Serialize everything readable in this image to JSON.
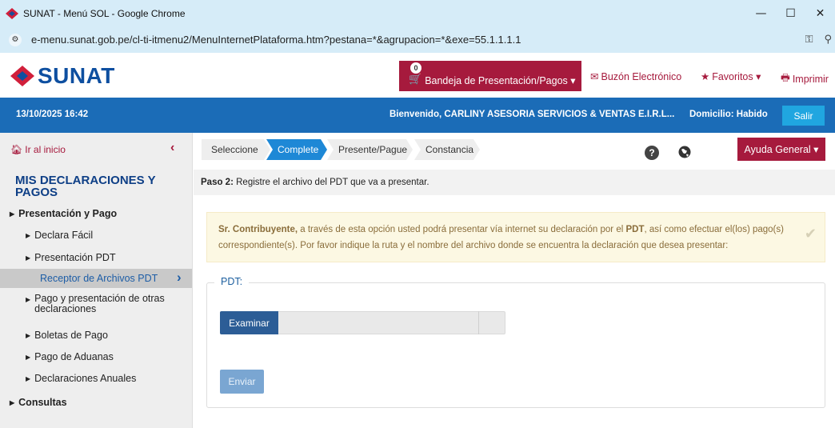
{
  "browser": {
    "window_title": "SUNAT - Menú SOL - Google Chrome",
    "url": "e-menu.sunat.gob.pe/cl-ti-itmenu2/MenuInternetPlataforma.htm?pestana=*&agrupacion=*&exe=55.1.1.1.1",
    "minimize": "—",
    "maximize": "☐",
    "close": "✕",
    "site_info": "⚙",
    "key_icon": "⚿",
    "zoom_icon": "⚲"
  },
  "header": {
    "logo_text": "SUNAT",
    "bandeja_label": "Bandeja de Presentación/Pagos ▾",
    "bandeja_badge": "0",
    "buzon_label": "Buzón Electrónico",
    "favoritos_label": "Favoritos ▾",
    "imprimir_label": "Imprimir"
  },
  "status_bar": {
    "datetime": "13/10/2025 16:42",
    "welcome": "Bienvenido, CARLINY ASESORIA SERVICIOS & VENTAS E.I.R.L...",
    "domicilio": "Domicilio: Habido",
    "salir": "Salir"
  },
  "sidebar": {
    "home_label": "Ir al inicio",
    "title": "MIS DECLARACIONES Y PAGOS",
    "items": [
      {
        "label": "Presentación y Pago"
      },
      {
        "label": "Declara Fácil"
      },
      {
        "label": "Presentación PDT"
      },
      {
        "label": "Receptor de Archivos PDT"
      },
      {
        "label": "Pago y presentación de otras declaraciones"
      },
      {
        "label": "Boletas de Pago"
      },
      {
        "label": "Pago de Aduanas"
      },
      {
        "label": "Declaraciones Anuales"
      },
      {
        "label": "Consultas"
      }
    ]
  },
  "steps": [
    {
      "label": "Seleccione"
    },
    {
      "label": "Complete"
    },
    {
      "label": "Presente/Pague"
    },
    {
      "label": "Constancia"
    }
  ],
  "help": {
    "question": "?",
    "ayuda_label": "Ayuda General ▾"
  },
  "paso": {
    "bold": "Paso 2:",
    "text": " Registre el archivo del PDT que va a presentar."
  },
  "alert": {
    "bold1": "Sr. Contribuyente,",
    "text1": " a través de esta opción usted podrá presentar vía internet su declaración por el ",
    "bold2": "PDT",
    "text2": ", así como efectuar el(los) pago(s) correspondiente(s). Por favor indique la ruta y el nombre del archivo donde se encuentra la declaración que desea presentar:",
    "check": "✔"
  },
  "form": {
    "legend": "PDT:",
    "examinar": "Examinar",
    "enviar": "Enviar"
  },
  "colors": {
    "brand_blue": "#1b6cb7",
    "brand_red": "#a61a3d",
    "step_active": "#1e88d6"
  }
}
